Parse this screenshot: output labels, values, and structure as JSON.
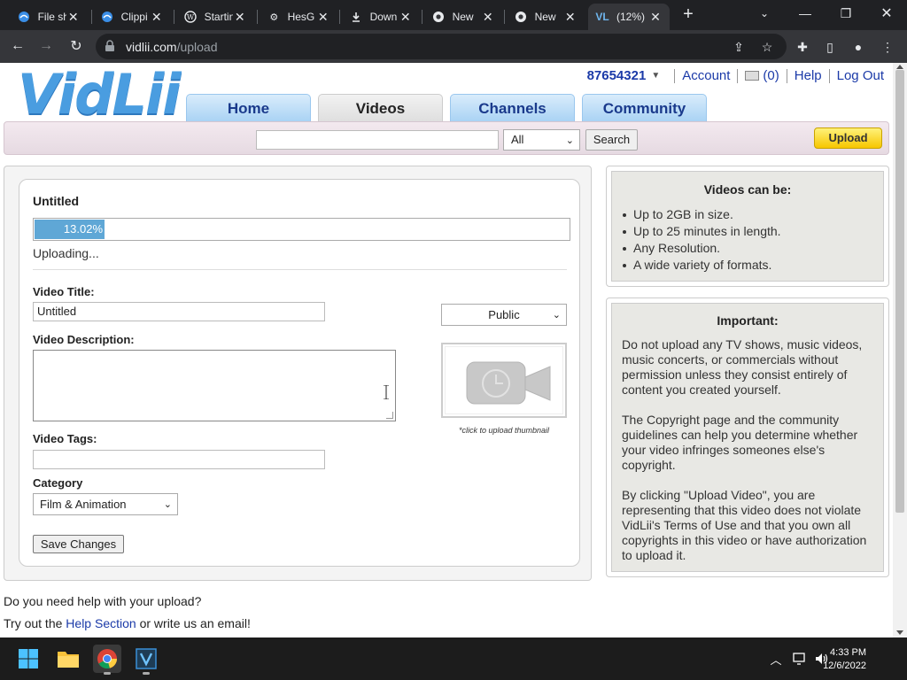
{
  "browser": {
    "tabs": [
      {
        "title": "File sh",
        "icon": "edge-icon"
      },
      {
        "title": "Clippi",
        "icon": "edge-icon"
      },
      {
        "title": "Startin",
        "icon": "wordpress-icon"
      },
      {
        "title": "HesG",
        "icon": "hes-icon"
      },
      {
        "title": "Down",
        "icon": "download-icon"
      },
      {
        "title": "New",
        "icon": "chrome-icon"
      },
      {
        "title": "New",
        "icon": "chrome-icon"
      },
      {
        "title": "(12%)",
        "icon": "vidlii-icon"
      }
    ],
    "url_host": "vidlii.com",
    "url_path": "/upload"
  },
  "site": {
    "logo": "VidLii",
    "user": {
      "name": "87654321",
      "account": "Account",
      "messages": "(0)",
      "help": "Help",
      "logout": "Log Out"
    },
    "nav": [
      {
        "label": "Home"
      },
      {
        "label": "Videos"
      },
      {
        "label": "Channels"
      },
      {
        "label": "Community"
      }
    ],
    "search": {
      "value": "",
      "scope": "All",
      "button": "Search",
      "upload_button": "Upload"
    }
  },
  "upload": {
    "file_name": "Untitled",
    "progress_text": "13.02%",
    "progress_value": 0.1302,
    "status": "Uploading...",
    "title_label": "Video Title:",
    "title_value": "Untitled",
    "privacy": "Public",
    "description_label": "Video Description:",
    "description_value": "",
    "thumbnail_caption": "*click to upload thumbnail",
    "tags_label": "Video Tags:",
    "tags_value": "",
    "category_label": "Category",
    "category_value": "Film & Animation",
    "save_button": "Save Changes"
  },
  "sidebar": {
    "info_title": "Videos can be:",
    "info_items": [
      "Up to 2GB in size.",
      "Up to 25 minutes in length.",
      "Any Resolution.",
      "A wide variety of formats."
    ],
    "important_title": "Important:",
    "important_paragraphs": [
      "Do not upload any TV shows, music videos, music concerts, or commercials without permission unless they consist entirely of content you created yourself.",
      "The Copyright page and the community guidelines can help you determine whether your video infringes someones else's copyright.",
      "By clicking \"Upload Video\", you are representing that this video does not violate VidLii's Terms of Use and that you own all copyrights in this video or have authorization to upload it."
    ]
  },
  "help": {
    "line1": "Do you need help with your upload?",
    "line2_prefix": "Try out the ",
    "line2_link": "Help Section",
    "line2_suffix": " or write us an email!"
  },
  "taskbar": {
    "time": "4:33 PM",
    "date": "12/6/2022"
  },
  "colors": {
    "accent_blue": "#4a9de0",
    "link_blue": "#1b3aa8",
    "progress_fill": "#5fa7d6",
    "upload_yellow": "#f7c600"
  }
}
